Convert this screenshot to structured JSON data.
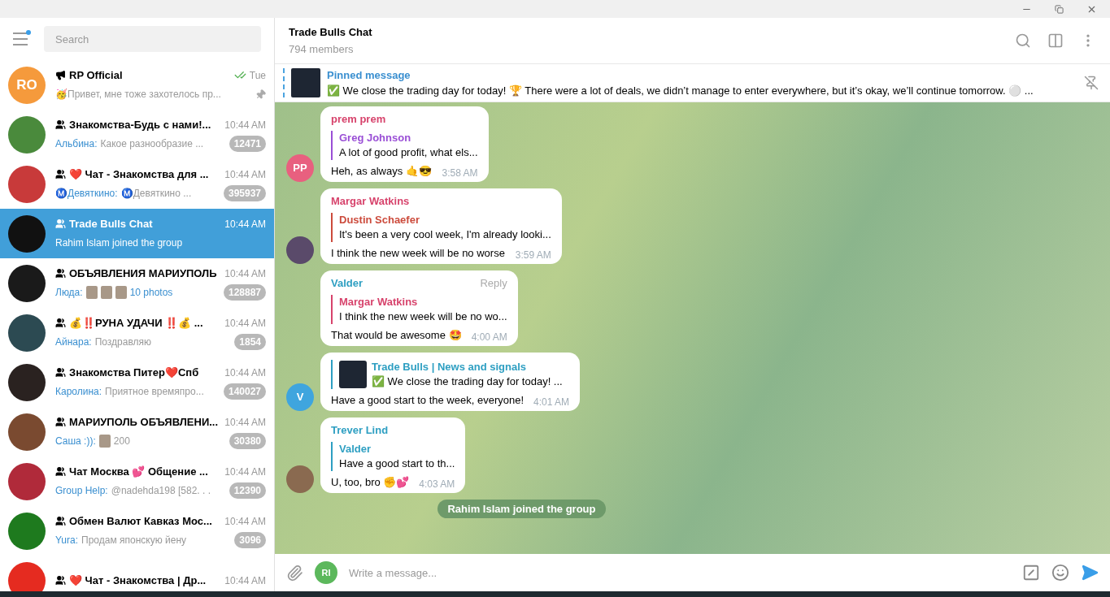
{
  "sidebar": {
    "search": {
      "placeholder": "Search"
    },
    "chats": [
      {
        "name": "RP Official",
        "kind": "channel",
        "time": "Tue",
        "read": true,
        "pinned": true,
        "selected": false,
        "avatar": {
          "initials": "RO",
          "color": "#f59a3c"
        },
        "preview": {
          "kind": "text",
          "text": "🥳Привет, мне тоже захотелось пр..."
        }
      },
      {
        "name": "Знакомства-Будь с нами!...",
        "kind": "group",
        "time": "10:44 AM",
        "selected": false,
        "avatar": {
          "color": "#4a8a3c"
        },
        "sender": "Альбина:",
        "preview": {
          "kind": "text",
          "text": "Какое разнообразие ..."
        },
        "badge": "12471"
      },
      {
        "name": "❤️ Чат - Знакомства для ...",
        "kind": "group",
        "time": "10:44 AM",
        "selected": false,
        "avatar": {
          "color": "#c83a3a"
        },
        "sender": "Ⓜ️Девяткино:",
        "preview": {
          "kind": "text",
          "text": "Ⓜ️Девяткино  ..."
        },
        "badge": "395937"
      },
      {
        "name": "Trade Bulls Chat",
        "kind": "group",
        "time": "10:44 AM",
        "selected": true,
        "avatar": {
          "color": "#111111"
        },
        "preview": {
          "kind": "text",
          "text": "Rahim Islam joined the group"
        }
      },
      {
        "name": "ОБЪЯВЛЕНИЯ МАРИУПОЛЬ",
        "kind": "group",
        "time": "10:44 AM",
        "selected": false,
        "avatar": {
          "color": "#1a1a1a"
        },
        "sender": "Люда:",
        "preview": {
          "kind": "album",
          "text": "10 photos"
        },
        "badge": "128887"
      },
      {
        "name": "💰‼️РУНА УДАЧИ ‼️💰 ...",
        "kind": "group",
        "time": "10:44 AM",
        "selected": false,
        "avatar": {
          "color": "#2c4a52"
        },
        "sender": "Айнара:",
        "preview": {
          "kind": "text",
          "text": "Поздравляю"
        },
        "badge": "1854"
      },
      {
        "name": "Знакомства Питер❤️Спб",
        "kind": "group",
        "time": "10:44 AM",
        "selected": false,
        "avatar": {
          "color": "#2a2220"
        },
        "sender": "Каролина:",
        "preview": {
          "kind": "text",
          "text": "Приятное времяпро..."
        },
        "badge": "140027"
      },
      {
        "name": "МАРИУПОЛЬ ОБЪЯВЛЕНИ...",
        "kind": "group",
        "time": "10:44 AM",
        "selected": false,
        "avatar": {
          "color": "#7a4a30"
        },
        "sender": "Саша :)):",
        "preview": {
          "kind": "photo",
          "text": "200"
        },
        "badge": "30380"
      },
      {
        "name": "Чат Москва 💕 Общение ...",
        "kind": "group",
        "time": "10:44 AM",
        "selected": false,
        "avatar": {
          "color": "#b02a3a"
        },
        "sender": "Group Help:",
        "preview": {
          "kind": "text",
          "text": "@nadehda198 [582. . ."
        },
        "badge": "12390"
      },
      {
        "name": "Обмен Валют Кавказ Мос...",
        "kind": "group",
        "time": "10:44 AM",
        "selected": false,
        "avatar": {
          "color": "#1e7a1e"
        },
        "sender": "Yura:",
        "preview": {
          "kind": "text",
          "text": "Продам японскую йену"
        },
        "badge": "3096"
      },
      {
        "name": "❤️ Чат - Знакомства | Др...",
        "kind": "group",
        "time": "10:44 AM",
        "selected": false,
        "avatar": {
          "color": "#e52b20"
        }
      }
    ]
  },
  "chat": {
    "title": "Trade Bulls Chat",
    "subtitle": "794 members",
    "pinned": {
      "label": "Pinned message",
      "text": "✅ We close the trading day for today! 🏆  There were a lot of deals, we didn’t manage to enter everywhere, but it’s okay, we’ll continue tomorrow. ⚪ ..."
    },
    "messages": [
      {
        "kind": "reply",
        "sender": {
          "name": "prem prem",
          "color": "#d7436c"
        },
        "avatar": {
          "initials": "PP",
          "color": "#e8607f"
        },
        "quote": {
          "name": "Greg Johnson",
          "text": "A lot of good profit, what els...",
          "color": "#9a4fd6"
        },
        "text": "Heh, as always 🤙😎",
        "time": "3:58 AM"
      },
      {
        "kind": "reply",
        "sender": {
          "name": "Margar Watkins",
          "color": "#d7436c"
        },
        "avatar": {
          "color": "#5a4a6a"
        },
        "quote": {
          "name": "Dustin Schaefer",
          "text": "It's been a very cool week, I'm already looki...",
          "color": "#cc4b3c"
        },
        "text": "I think the new week will be no worse",
        "time": "3:59 AM"
      },
      {
        "kind": "reply",
        "sender": {
          "name": "Valder",
          "color": "#2e9fc2"
        },
        "quote": {
          "name": "Margar Watkins",
          "text": "I think the new week will be no wo...",
          "color": "#d7436c"
        },
        "text": "That would be awesome 🤩",
        "time": "4:00 AM",
        "hint": "Reply"
      },
      {
        "kind": "forward",
        "avatar": {
          "initials": "V",
          "color": "#3fa5de"
        },
        "quote": {
          "name": "Trade Bulls | News and signals",
          "text": "✅ We close the trading day for today! ...",
          "color": "#2e9fc2"
        },
        "text": "Have a good start to the week, everyone!",
        "time": "4:01 AM"
      },
      {
        "kind": "reply",
        "sender": {
          "name": "Trever Lind",
          "color": "#2e9fc2"
        },
        "avatar": {
          "color": "#8a6a50"
        },
        "quote": {
          "name": "Valder",
          "text": "Have a good start to th...",
          "color": "#2e9fc2"
        },
        "text": "U, too, bro ✊💕",
        "time": "4:03 AM"
      }
    ],
    "service": "Rahim Islam joined the group",
    "composer": {
      "placeholder": "Write a message...",
      "avatar": {
        "initials": "RI",
        "color": "#5cb85c"
      }
    }
  }
}
